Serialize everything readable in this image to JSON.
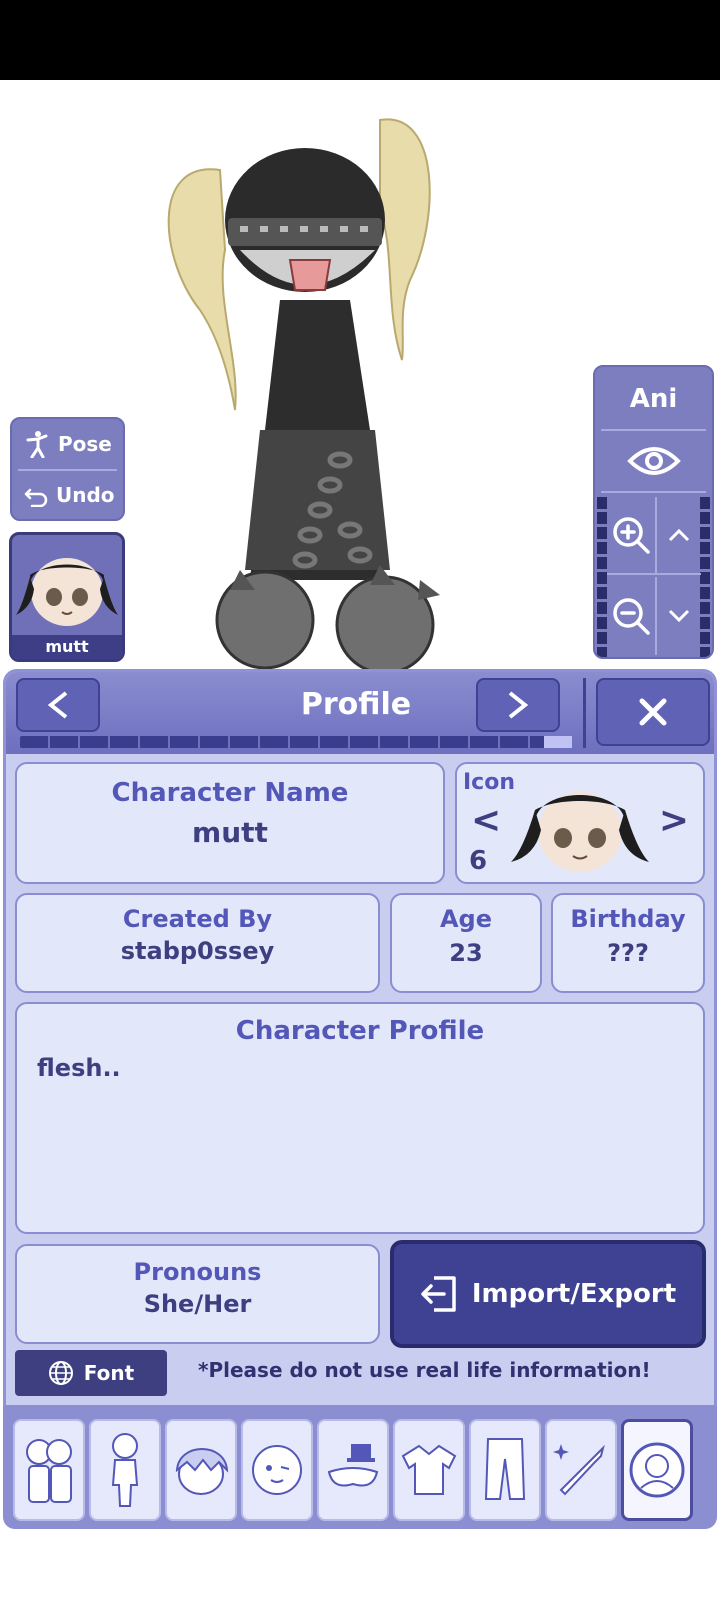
{
  "pose": {
    "pose_label": "Pose",
    "undo_label": "Undo"
  },
  "avatar": {
    "name": "mutt"
  },
  "controls": {
    "ani_label": "Ani"
  },
  "header": {
    "title": "Profile",
    "prev": "<",
    "next": ">",
    "close": "X",
    "progress": 0.95
  },
  "profile": {
    "name_label": "Character Name",
    "name_value": "mutt",
    "icon_label": "Icon",
    "icon_number": "6",
    "icon_prev": "<",
    "icon_next": ">",
    "created_label": "Created By",
    "created_value": "stabp0ssey",
    "age_label": "Age",
    "age_value": "23",
    "birthday_label": "Birthday",
    "birthday_value": "???",
    "profile_label": "Character Profile",
    "profile_text": "flesh..",
    "pronouns_label": "Pronouns",
    "pronouns_value": "She/Her",
    "import_label": "Import/Export"
  },
  "footer": {
    "font_label": "Font",
    "notice": "*Please do not use real life information!"
  },
  "tabs": [
    {
      "icon": "group-icon"
    },
    {
      "icon": "body-icon"
    },
    {
      "icon": "hair-icon"
    },
    {
      "icon": "face-icon"
    },
    {
      "icon": "accessory-icon"
    },
    {
      "icon": "top-icon"
    },
    {
      "icon": "bottom-icon"
    },
    {
      "icon": "weapon-icon"
    },
    {
      "icon": "profile-icon"
    }
  ],
  "colors": {
    "accent": "#6d6fbf",
    "dark": "#3f4192",
    "panel": "#e3e7fa",
    "text": "#5357b8"
  }
}
